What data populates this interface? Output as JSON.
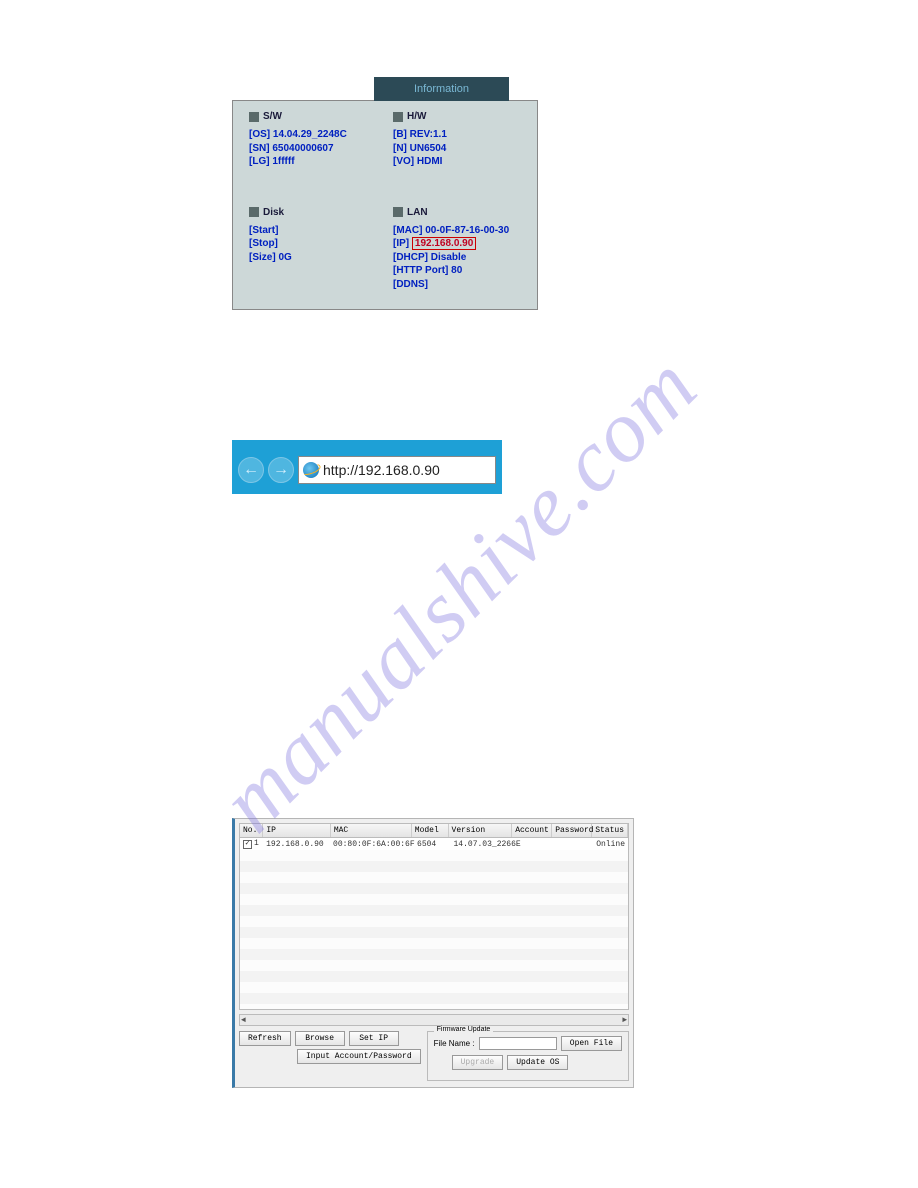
{
  "watermark": "manualshive.com",
  "info": {
    "tab": "Information",
    "sw_label": "S/W",
    "hw_label": "H/W",
    "disk_label": "Disk",
    "lan_label": "LAN",
    "os": "[OS]  14.04.29_2248C",
    "sn": "[SN]  65040000607",
    "lg": "[LG]  1fffff",
    "b": "[B]  REV:1.1",
    "n": "[N]  UN6504",
    "vo": "[VO]  HDMI",
    "start": "[Start]",
    "stop": "[Stop]",
    "size": "[Size]     0G",
    "mac": "[MAC]  00-0F-87-16-00-30",
    "ip_label": "[IP]",
    "ip_value": "192.168.0.90",
    "dhcp": "[DHCP]  Disable",
    "http": "[HTTP Port]  80",
    "ddns": "[DDNS]"
  },
  "browser": {
    "url": "http://192.168.0.90"
  },
  "scan": {
    "headers": {
      "no": "No.",
      "ip": "IP",
      "mac": "MAC",
      "model": "Model",
      "version": "Version",
      "account": "Account",
      "password": "Password",
      "status": "Status"
    },
    "row": {
      "no": "1",
      "ip": "192.168.0.90",
      "mac": "00:80:0F:6A:00:6F",
      "model": "6504",
      "version": "14.07.03_2266E",
      "account": "",
      "password": "",
      "status": "Online"
    },
    "buttons": {
      "refresh": "Refresh",
      "browse": "Browse",
      "setip": "Set IP",
      "inputacct": "Input Account/Password",
      "upgrade": "Upgrade",
      "updateos": "Update OS",
      "openfile": "Open File"
    },
    "fw": {
      "legend": "Firmware Update",
      "filename_label": "File Name :"
    }
  }
}
